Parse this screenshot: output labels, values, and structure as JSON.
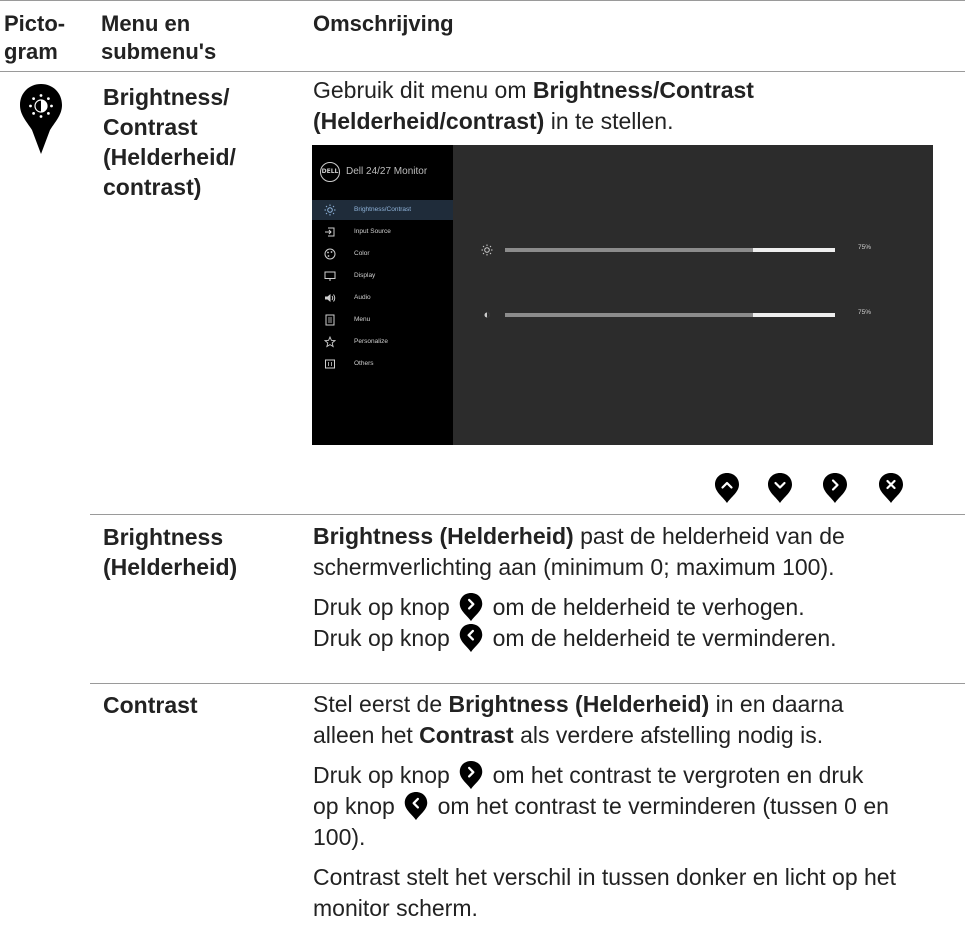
{
  "header": {
    "col1_line1": "Picto-",
    "col1_line2": "gram",
    "col2_line1": "Menu en",
    "col2_line2": "submenu's",
    "col3": "Omschrijving"
  },
  "row_brightness_contrast": {
    "icon": "brightness-contrast-icon",
    "title_lines": [
      "Brightness/",
      "Contrast",
      "(Helderheid/",
      "contrast)"
    ],
    "desc_pre": "Gebruik dit menu om ",
    "desc_bold1": "Brightness/Contrast",
    "desc_bold2": "(Helderheid/contrast)",
    "desc_post": " in te stellen.",
    "osd": {
      "model": "Dell 24/27 Monitor",
      "logo": "DELL",
      "menu_items": [
        {
          "label": "Brightness/Contrast",
          "icon": "brightness-icon",
          "active": true
        },
        {
          "label": "Input Source",
          "icon": "input-source-icon",
          "active": false
        },
        {
          "label": "Color",
          "icon": "color-icon",
          "active": false
        },
        {
          "label": "Display",
          "icon": "display-icon",
          "active": false
        },
        {
          "label": "Audio",
          "icon": "audio-icon",
          "active": false
        },
        {
          "label": "Menu",
          "icon": "menu-icon",
          "active": false
        },
        {
          "label": "Personalize",
          "icon": "star-icon",
          "active": false
        },
        {
          "label": "Others",
          "icon": "others-icon",
          "active": false
        }
      ],
      "brightness_value": "75%",
      "brightness_fraction": 0.75,
      "contrast_value": "75%",
      "contrast_fraction": 0.75
    },
    "nav_buttons": [
      "up-button-icon",
      "down-button-icon",
      "right-button-icon",
      "close-button-icon"
    ]
  },
  "row_brightness": {
    "title_line1": "Brightness",
    "title_line2": "(Helderheid)",
    "p1_bold": "Brightness (Helderheid)",
    "p1_rest_line1": " past de helderheid van de",
    "p1_line2": "schermverlichting aan (minimum 0; maximum 100).",
    "p2_pre": "Druk op knop",
    "p2_post": "om de helderheid te verhogen.",
    "p3_pre": "Druk op knop",
    "p3_post": "om de helderheid te verminderen."
  },
  "row_contrast": {
    "title": "Contrast",
    "p1_pre": "Stel eerst de ",
    "p1_bold": "Brightness (Helderheid)",
    "p1_post": " in en daarna",
    "p1_line2_pre": "alleen het ",
    "p1_line2_bold": "Contrast",
    "p1_line2_post": " als verdere afstelling nodig is.",
    "p2_line1_pre": "Druk op knop",
    "p2_line1_post": "om het contrast te vergroten en druk",
    "p2_line2_pre": "op knop",
    "p2_line2_post": "om het contrast te verminderen (tussen 0 en",
    "p2_line3": "100).",
    "p3_line1": "Contrast stelt het verschil in tussen donker en licht op het",
    "p3_line2": "monitor scherm."
  }
}
